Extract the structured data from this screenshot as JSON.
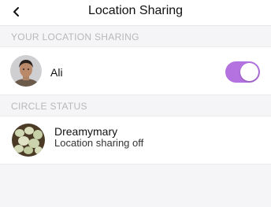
{
  "header": {
    "title": "Location Sharing",
    "back_icon": "chevron-left-icon"
  },
  "your_location": {
    "section_label": "YOUR LOCATION SHARING",
    "user": {
      "name": "Ali",
      "sharing_enabled": true
    }
  },
  "circle_status": {
    "section_label": "CIRCLE STATUS",
    "members": [
      {
        "name": "Dreamymary",
        "status": "Location sharing off"
      }
    ]
  },
  "colors": {
    "toggle_on": "#b472e0",
    "section_label": "#b8b8bc",
    "background": "#f5f5f7"
  }
}
